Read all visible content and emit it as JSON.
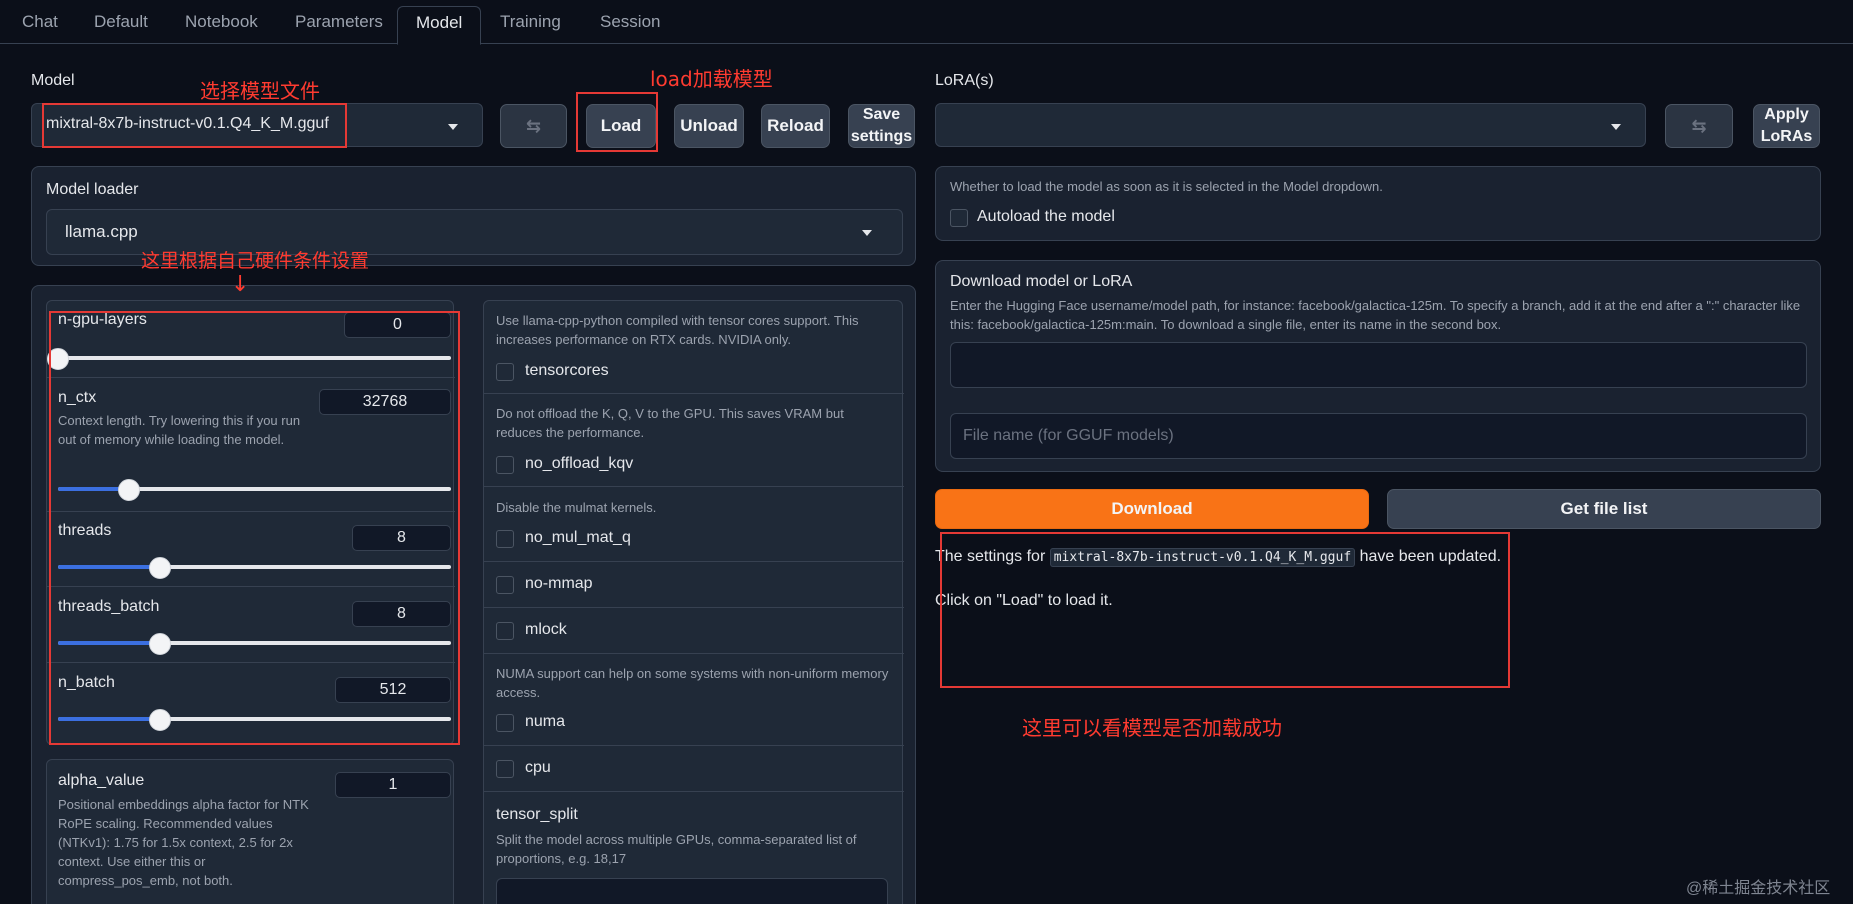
{
  "tabs": [
    "Chat",
    "Default",
    "Notebook",
    "Parameters",
    "Model",
    "Training",
    "Session"
  ],
  "active_tab": "Model",
  "model": {
    "label": "Model",
    "selected": "mixtral-8x7b-instruct-v0.1.Q4_K_M.gguf",
    "buttons": {
      "refresh_icon": "refresh-icon",
      "load": "Load",
      "unload": "Unload",
      "reload": "Reload",
      "save_settings_line1": "Save",
      "save_settings_line2": "settings"
    }
  },
  "lora": {
    "label": "LoRA(s)",
    "selected": "",
    "apply_line1": "Apply",
    "apply_line2": "LoRAs"
  },
  "model_loader": {
    "label": "Model loader",
    "selected": "llama.cpp"
  },
  "params": {
    "n_gpu_layers": {
      "label": "n-gpu-layers",
      "value": "0",
      "level": 0.0
    },
    "n_ctx": {
      "label": "n_ctx",
      "value": "32768",
      "level": 0.18,
      "desc": "Context length. Try lowering this if you run out of memory while loading the model."
    },
    "threads": {
      "label": "threads",
      "value": "8",
      "level": 0.26
    },
    "threads_batch": {
      "label": "threads_batch",
      "value": "8",
      "level": 0.26
    },
    "n_batch": {
      "label": "n_batch",
      "value": "512",
      "level": 0.26
    },
    "alpha_value": {
      "label": "alpha_value",
      "value": "1",
      "desc": "Positional embeddings alpha factor for NTK RoPE scaling. Recommended values (NTKv1): 1.75 for 1.5x context, 2.5 for 2x context. Use either this or compress_pos_emb, not both."
    }
  },
  "options": {
    "tensorcores_desc": "Use llama-cpp-python compiled with tensor cores support. This increases performance on RTX cards. NVIDIA only.",
    "tensorcores": "tensorcores",
    "no_offload_kqv_desc": "Do not offload the K, Q, V to the GPU. This saves VRAM but reduces the performance.",
    "no_offload_kqv": "no_offload_kqv",
    "no_mul_mat_q_desc": "Disable the mulmat kernels.",
    "no_mul_mat_q": "no_mul_mat_q",
    "no_mmap": "no-mmap",
    "mlock": "mlock",
    "numa_desc": "NUMA support can help on some systems with non-uniform memory access.",
    "numa": "numa",
    "cpu": "cpu",
    "tensor_split_label": "tensor_split",
    "tensor_split_desc": "Split the model across multiple GPUs, comma-separated list of proportions, e.g. 18,17"
  },
  "autoload": {
    "desc": "Whether to load the model as soon as it is selected in the Model dropdown.",
    "label": "Autoload the model"
  },
  "download": {
    "title": "Download model or LoRA",
    "desc": "Enter the Hugging Face username/model path, for instance: facebook/galactica-125m. To specify a branch, add it at the end after a \":\" character like this: facebook/galactica-125m:main. To download a single file, enter its name in the second box.",
    "path_value": "",
    "filename_placeholder": "File name (for GGUF models)",
    "download_button": "Download",
    "file_list_button": "Get file list"
  },
  "status": {
    "line1_prefix": "The settings for",
    "line1_code": "mixtral-8x7b-instruct-v0.1.Q4_K_M.gguf",
    "line1_suffix": "have been updated.",
    "line2": "Click on \"Load\" to load it."
  },
  "annotations": {
    "select_model": "选择模型文件",
    "load_model": "load加载模型",
    "hardware": "这里根据自己硬件条件设置",
    "check_loaded": "这里可以看模型是否加载成功",
    "arrow": "↓"
  },
  "watermark": "@稀土掘金技术社区",
  "colors": {
    "accent": "#f97316",
    "annotation": "#e53935",
    "slider_fill": "#3b6fe0"
  }
}
